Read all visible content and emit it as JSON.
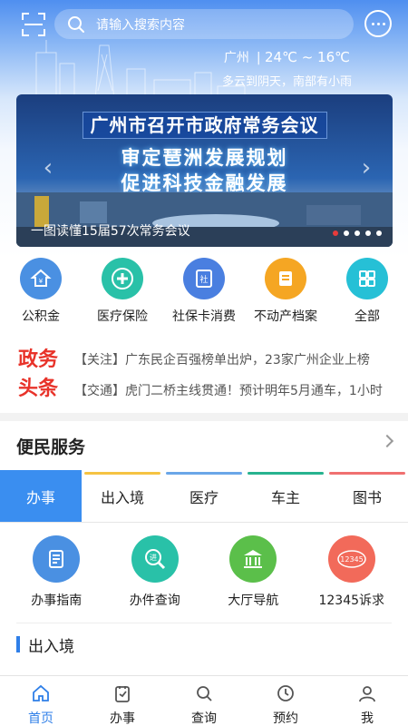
{
  "header": {
    "search_placeholder": "请输入搜索内容",
    "city": "广州",
    "temperature": "24℃ ~ 16℃",
    "weather_desc": "多云到阴天，南部有小雨"
  },
  "banner": {
    "headline": "广州市召开市政府常务会议",
    "subline_1": "审定琶洲发展规划",
    "subline_2": "促进科技金融发展",
    "caption": "一图读懂15届57次常务会议",
    "slide_count": 5,
    "active_slide": 1
  },
  "quick_services": [
    {
      "label": "公积金",
      "icon": "housing-fund-icon",
      "color": "#4a90e2"
    },
    {
      "label": "医疗保险",
      "icon": "medical-cross-icon",
      "color": "#29c1a8"
    },
    {
      "label": "社保卡消费",
      "icon": "social-card-icon",
      "color": "#4a7fe0"
    },
    {
      "label": "不动产档案",
      "icon": "property-file-icon",
      "color": "#f5a623"
    },
    {
      "label": "全部",
      "icon": "grid-icon",
      "color": "#26c0d6"
    }
  ],
  "news": {
    "logo_top": "政务",
    "logo_bottom": "头条",
    "items": [
      "【关注】广东民企百强榜单出炉，23家广州企业上榜",
      "【交通】虎门二桥主线贯通！预计明年5月通车，1小时"
    ]
  },
  "services": {
    "title": "便民服务",
    "tabs": [
      {
        "label": "办事",
        "color": "#3a8ef0"
      },
      {
        "label": "出入境",
        "color": "#f5c342"
      },
      {
        "label": "医疗",
        "color": "#6aa6e8"
      },
      {
        "label": "车主",
        "color": "#27b38f"
      },
      {
        "label": "图书",
        "color": "#f07070"
      }
    ],
    "active_tab": 0,
    "items": [
      {
        "label": "办事指南",
        "icon": "guide-icon",
        "color": "#4a90e2"
      },
      {
        "label": "办件查询",
        "icon": "progress-query-icon",
        "color": "#29c1a8"
      },
      {
        "label": "大厅导航",
        "icon": "hall-building-icon",
        "color": "#5bbf4a"
      },
      {
        "label": "12345诉求",
        "icon": "hotline-icon",
        "color": "#f26a5a"
      }
    ],
    "section_title": "出入境"
  },
  "bottom_nav": [
    {
      "label": "首页",
      "icon": "home-icon"
    },
    {
      "label": "办事",
      "icon": "task-icon"
    },
    {
      "label": "查询",
      "icon": "search-icon"
    },
    {
      "label": "预约",
      "icon": "clock-icon"
    },
    {
      "label": "我",
      "icon": "user-icon"
    }
  ],
  "bottom_nav_active": 0
}
